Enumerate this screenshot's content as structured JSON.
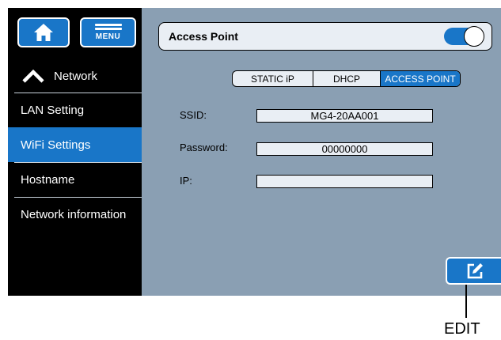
{
  "sidebar": {
    "home_icon": "home-icon",
    "menu_label": "MENU",
    "section": {
      "label": "Network",
      "icon": "chevron-up-icon"
    },
    "items": [
      {
        "label": "LAN Setting",
        "selected": false
      },
      {
        "label": "WiFi Settings",
        "selected": true
      },
      {
        "label": "Hostname",
        "selected": false
      },
      {
        "label": "Network information",
        "selected": false
      }
    ]
  },
  "panel": {
    "title": "Access Point",
    "toggle_on": true,
    "modes": [
      "STATIC iP",
      "DHCP",
      "ACCESS POINT"
    ],
    "selected_mode": "ACCESS POINT",
    "fields": {
      "ssid": {
        "label": "SSID:",
        "value": "MG4-20AA001"
      },
      "password": {
        "label": "Password:",
        "value": "00000000"
      },
      "ip": {
        "label": "IP:",
        "value": ""
      }
    },
    "edit_icon": "edit-icon"
  },
  "annotation": {
    "caption": "EDIT"
  },
  "colors": {
    "accent": "#1976c8",
    "panel_bg": "#8a9fb3",
    "sidebar_bg": "#000000",
    "field_bg": "#e9eef4"
  }
}
